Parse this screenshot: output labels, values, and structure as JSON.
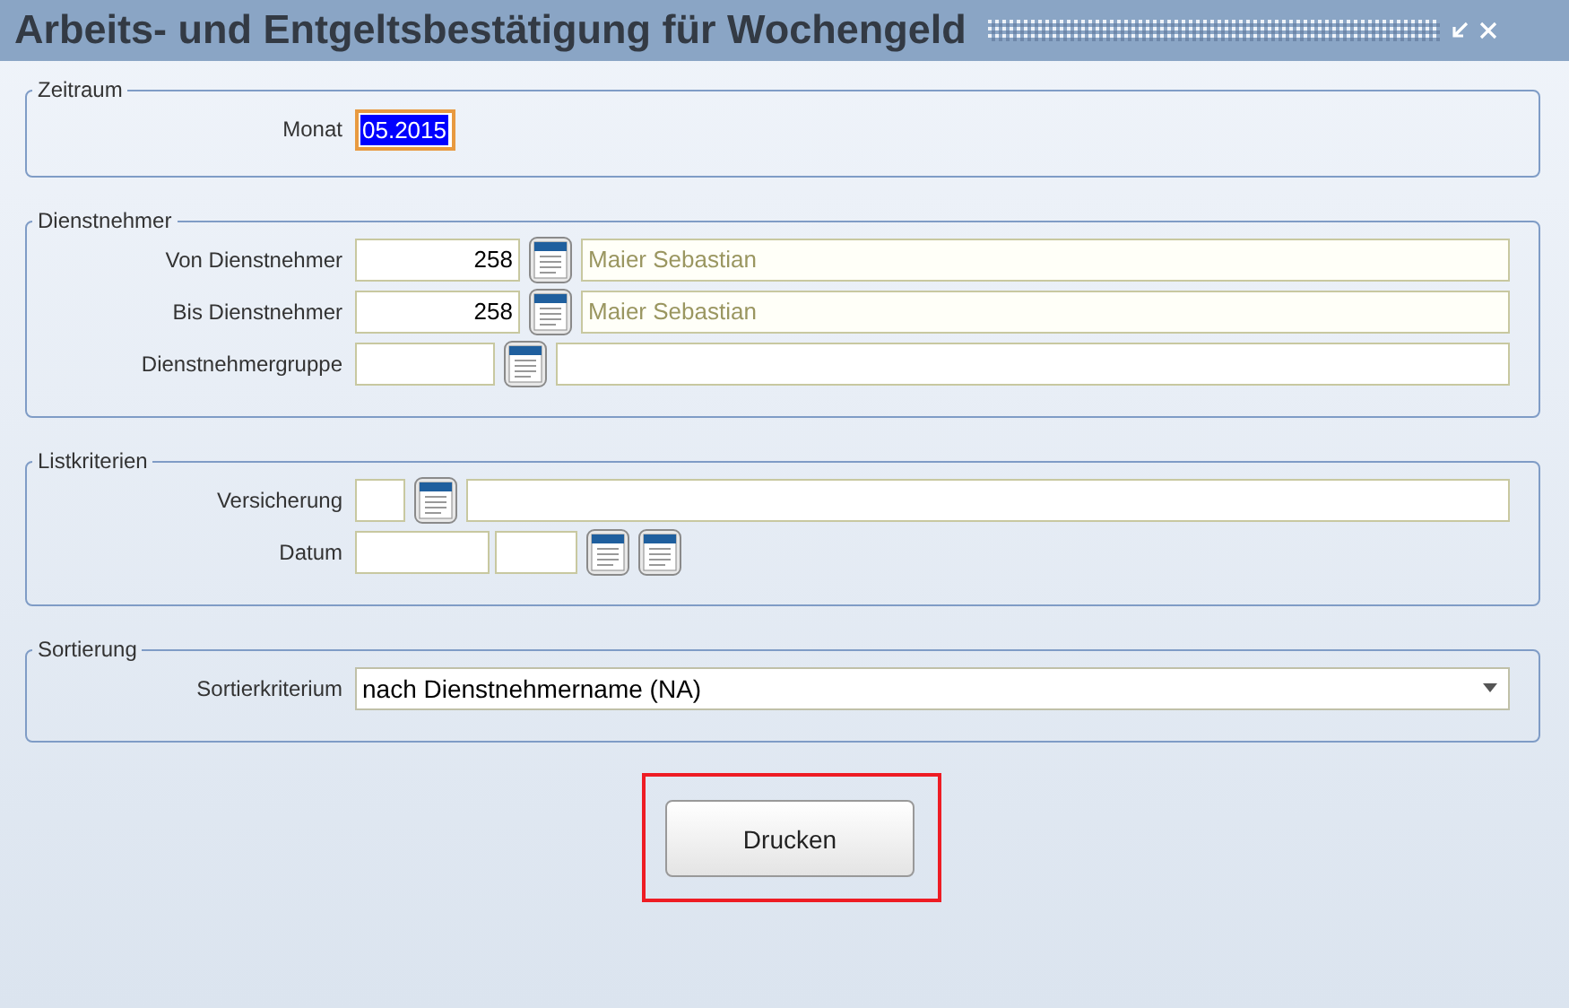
{
  "window": {
    "title": "Arbeits- und Entgeltsbestätigung für Wochengeld"
  },
  "sections": [
    {
      "title": "Zeitraum",
      "rows": [
        {
          "kind": "month",
          "label": "Monat",
          "value": "05.2015",
          "selected": true
        }
      ]
    },
    {
      "title": "Dienstnehmer",
      "rows": [
        {
          "kind": "employee",
          "label": "Von Dienstnehmer",
          "value": "258",
          "name": "Maier Sebastian",
          "disabled": true
        },
        {
          "kind": "employee",
          "label": "Bis Dienstnehmer",
          "value": "258",
          "name": "Maier Sebastian",
          "disabled": true
        },
        {
          "kind": "group",
          "label": "Dienstnehmergruppe"
        }
      ]
    },
    {
      "title": "Listkriterien",
      "rows": [
        {
          "kind": "insurance",
          "label": "Versicherung"
        },
        {
          "kind": "date",
          "label": "Datum"
        }
      ]
    },
    {
      "title": "Sortierung",
      "rows": [
        {
          "kind": "select",
          "label": "Sortierkriterium",
          "value": "nach Dienstnehmername (NA)"
        }
      ]
    }
  ],
  "print_button": {
    "label": "Drucken",
    "highlighted": true
  }
}
